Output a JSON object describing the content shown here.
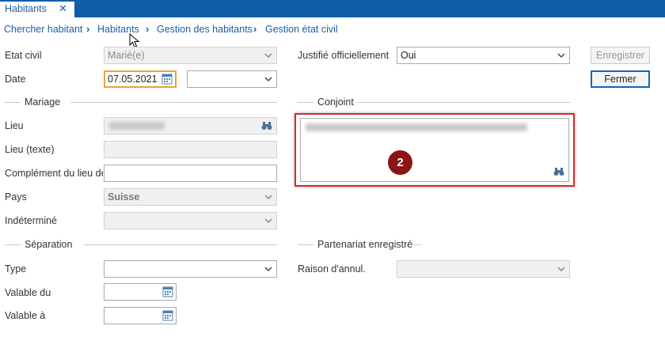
{
  "tab": {
    "label": "Habitants",
    "close": "✕"
  },
  "breadcrumb": [
    "Chercher habitant",
    "Habitants",
    "Gestion des habitants",
    "Gestion état civil"
  ],
  "labels": {
    "etat_civil": "Etat civil",
    "date": "Date",
    "lieu": "Lieu",
    "lieu_texte": "Lieu (texte)",
    "complement": "Complément du lieu de",
    "pays": "Pays",
    "indetermine": "Indéterminé",
    "type": "Type",
    "valable_du": "Valable du",
    "valable_a": "Valable à",
    "justifie": "Justifié officiellement",
    "raison": "Raison d'annul."
  },
  "sections": {
    "mariage": "Mariage",
    "conjoint": "Conjoint",
    "separation": "Séparation",
    "partenariat": "Partenariat enregistré"
  },
  "fields": {
    "etat_civil": "Marié(e)",
    "date": "07.05.2021",
    "pays": "Suisse",
    "justifie": "Oui"
  },
  "buttons": {
    "enregistrer": "Enregistrer",
    "fermer": "Fermer"
  },
  "badge": "2",
  "colors": {
    "accent": "#0f5ea8",
    "link": "#1a5fa8",
    "highlight": "#d62a2a",
    "badge": "#8b1414",
    "focus": "#e8a33d"
  },
  "icons": {
    "dropdown": "chevron-down-icon",
    "calendar": "calendar-icon",
    "search": "binoculars-icon",
    "cursor": "mouse-pointer-icon"
  }
}
